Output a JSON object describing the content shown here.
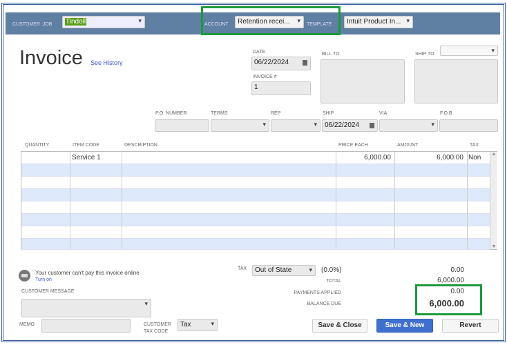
{
  "header": {
    "customer_job_label": "CUSTOMER :JOB",
    "customer_job": "Tindoll",
    "account_label": "ACCOUNT",
    "account": "Retention recei...",
    "template_label": "TEMPLATE",
    "template": "Intuit Product In..."
  },
  "title": "Invoice",
  "see_history": "See History",
  "date_label": "DATE",
  "date": "06/22/2024",
  "invoice_no_label": "INVOICE #",
  "invoice_no": "1",
  "bill_to_label": "BILL TO",
  "ship_to_label": "SHIP TO",
  "fields": {
    "po_label": "P.O. NUMBER",
    "terms_label": "TERMS",
    "rep_label": "REP",
    "ship_label": "SHIP",
    "ship_date": "06/22/2024",
    "via_label": "VIA",
    "fob_label": "F.O.B."
  },
  "table": {
    "headers": [
      "QUANTITY",
      "ITEM CODE",
      "DESCRIPTION",
      "PRICE EACH",
      "AMOUNT",
      "TAX"
    ],
    "rows": [
      {
        "quantity": "",
        "item": "Service 1",
        "description": "",
        "price": "6,000.00",
        "amount": "6,000.00",
        "tax": "Non"
      }
    ]
  },
  "online": {
    "message": "Your customer can't pay this invoice online",
    "turn_on": "Turn on"
  },
  "customer_message_label": "CUSTOMER MESSAGE",
  "memo_label": "MEMO",
  "tax_code_label1": "CUSTOMER",
  "tax_code_label2": "TAX CODE",
  "tax_code": "Tax",
  "totals": {
    "tax_label": "TAX",
    "tax_item": "Out of State",
    "tax_rate": "(0.0%)",
    "tax_amount": "0.00",
    "total_label": "TOTAL",
    "total": "6,000.00",
    "payments_label": "PAYMENTS APPLIED",
    "payments": "0.00",
    "balance_label": "BALANCE DUE",
    "balance": "6,000.00"
  },
  "buttons": {
    "save_close": "Save & Close",
    "save_new": "Save & New",
    "revert": "Revert"
  },
  "colors": {
    "topbar": "#5f7fa3",
    "highlight": "#1a9a3a",
    "primary": "#3f6fcf"
  }
}
